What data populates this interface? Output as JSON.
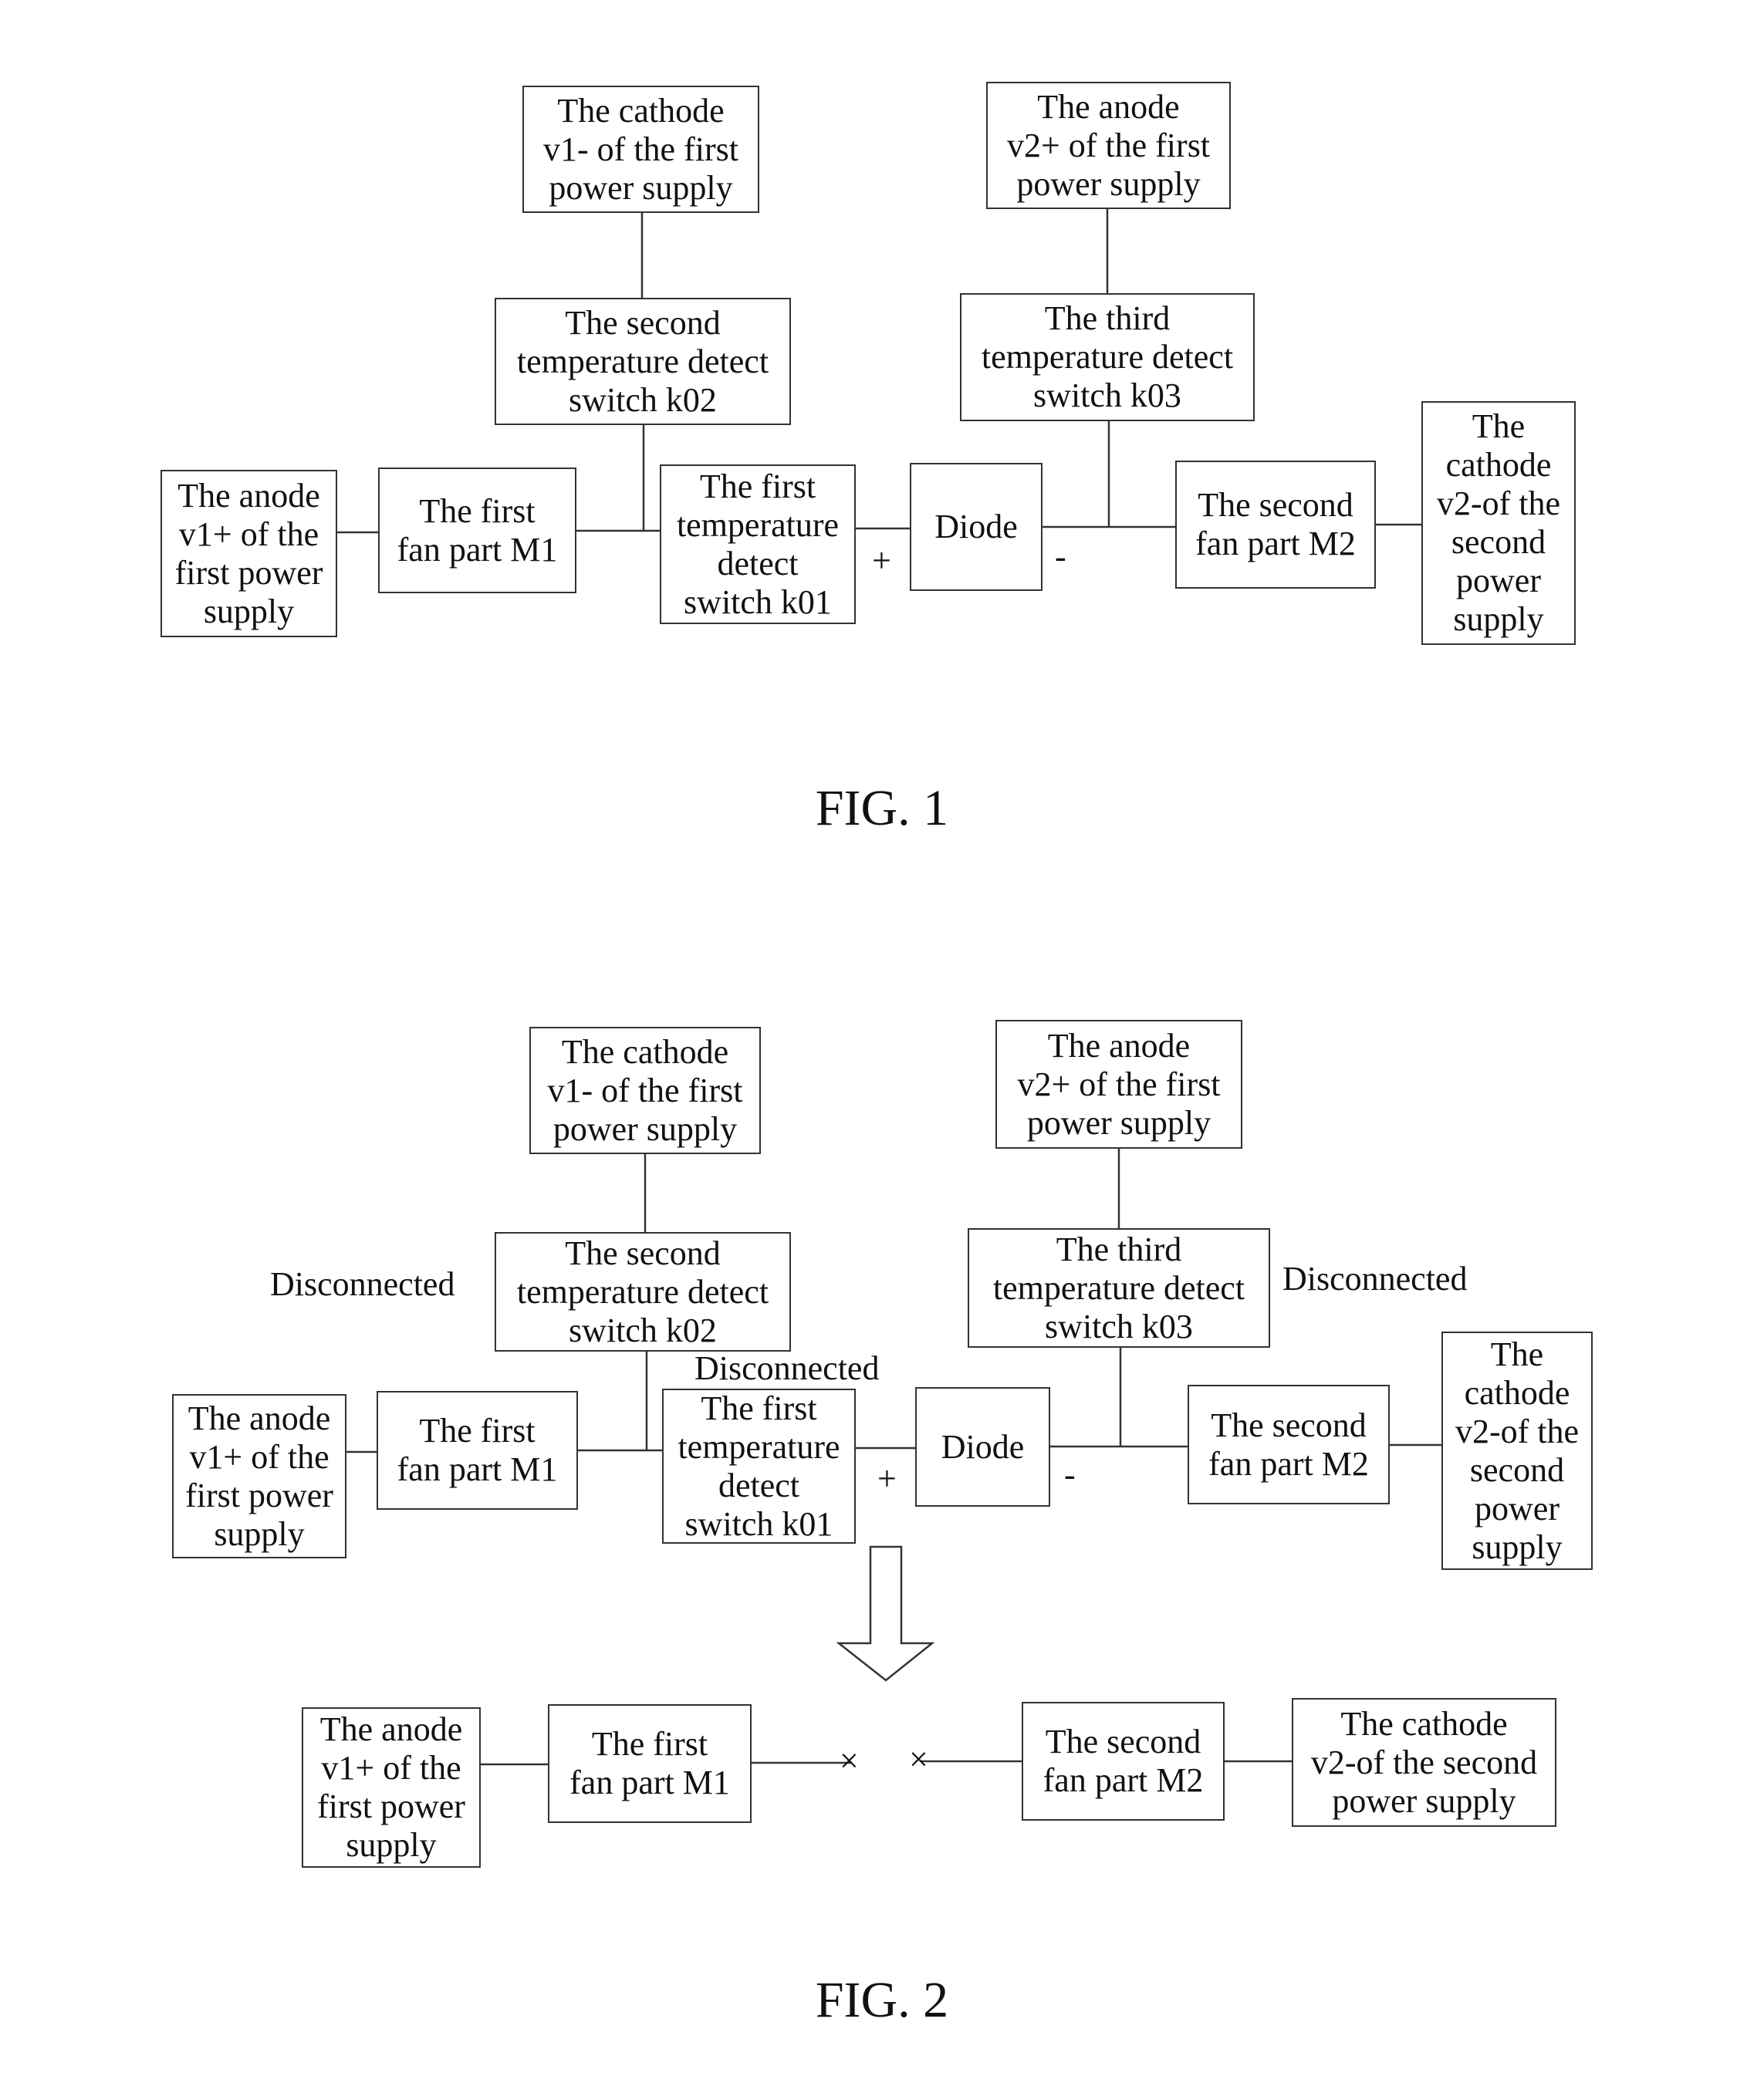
{
  "fig1": {
    "caption": "FIG. 1",
    "cathode_v1": "The cathode\nv1- of the first\npower supply",
    "anode_v2": "The anode\nv2+ of the first\npower supply",
    "switch_k02": "The second\ntemperature detect\nswitch k02",
    "switch_k03": "The third\ntemperature detect\nswitch k03",
    "anode_v1": "The anode\nv1+ of the\nfirst power\nsupply",
    "fan_m1": "The first\nfan part M1",
    "switch_k01": "The first\ntemperature\ndetect\nswitch k01",
    "diode": "Diode",
    "fan_m2": "The second\nfan part M2",
    "cathode_v2": "The\ncathode\nv2-of the\nsecond\npower\nsupply",
    "plus": "+",
    "minus": "-"
  },
  "fig2": {
    "caption": "FIG. 2",
    "cathode_v1": "The cathode\nv1- of the first\npower supply",
    "anode_v2": "The anode\nv2+ of the first\npower supply",
    "switch_k02": "The second\ntemperature detect\nswitch k02",
    "switch_k03": "The third\ntemperature detect\nswitch k03",
    "anode_v1": "The anode\nv1+ of the\nfirst power\nsupply",
    "fan_m1": "The first\nfan part M1",
    "switch_k01": "The first\ntemperature\ndetect\nswitch k01",
    "diode": "Diode",
    "fan_m2": "The second\nfan part M2",
    "cathode_v2": "The\ncathode\nv2-of the\nsecond\npower\nsupply",
    "plus": "+",
    "minus": "-",
    "disconnected_k02": "Disconnected",
    "disconnected_k03": "Disconnected",
    "disconnected_k01": "Disconnected",
    "result": {
      "anode_v1": "The anode\nv1+ of the\nfirst power\nsupply",
      "fan_m1": "The first\nfan part M1",
      "fan_m2": "The second\nfan part M2",
      "cathode_v2": "The cathode\nv2-of the second\npower supply",
      "break_mark": "×"
    }
  }
}
